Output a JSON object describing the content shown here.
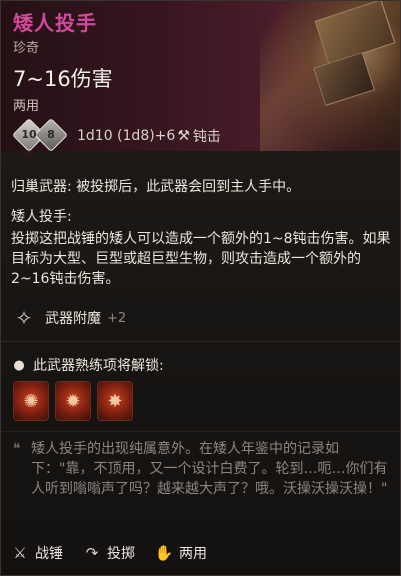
{
  "item": {
    "name": "矮人投手",
    "rarity": "珍奇",
    "damage": "7~16伤害",
    "handedness": "两用",
    "dice": {
      "icons": [
        "dice-d10",
        "dice-d8"
      ],
      "die1_label": "10",
      "die2_label": "8",
      "formula": "1d10 (1d8)+6",
      "damage_icon": "blunt-hammer-icon",
      "damage_type": "钝击"
    }
  },
  "details": {
    "throw_line": "归巢武器: 被投掷后，此武器会回到主人手中。",
    "ability_title": "矮人投手:",
    "ability_desc": "投掷这把战锤的矮人可以造成一个额外的1~8钝击伤害。如果目标为大型、巨型或超巨型生物，则攻击造成一个额外的2~16钝击伤害。",
    "enchant_label": "武器附魔",
    "enchant_bonus": "+2"
  },
  "proficiency": {
    "unlock_text": "此武器熟练项将解锁:",
    "actions": [
      "action-icon-1",
      "action-icon-2",
      "action-icon-3"
    ]
  },
  "flavor_text": "矮人投手的出现纯属意外。在矮人年鉴中的记录如下：\"靠，不顶用，又一个设计白费了。轮到…呃…你们有人听到嗡嗡声了吗？越来越大声了？哦。沃操沃操沃操！\"",
  "properties": [
    {
      "icon": "warhammer-icon",
      "label": "战锤"
    },
    {
      "icon": "throw-icon",
      "label": "投掷"
    },
    {
      "icon": "hand-icon",
      "label": "两用"
    }
  ],
  "colors": {
    "title": "#d2489b",
    "action_icon": "#c9421f"
  }
}
